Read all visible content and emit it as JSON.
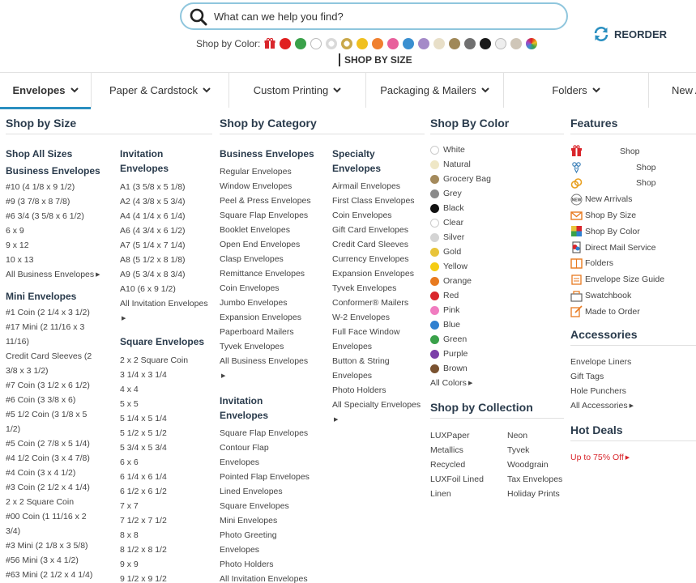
{
  "search": {
    "placeholder": "What can we help you find?"
  },
  "color_bar": {
    "label": "Shop by Color:",
    "swatches": [
      "#e02020",
      "#3aa14a",
      "#ffffff",
      "#d9d9d9",
      "#c9a84a",
      "#f0c020",
      "#f08030",
      "#e8609c",
      "#3a8fd0",
      "#a48ac8",
      "#e8dfc8",
      "#a08858",
      "#707070",
      "#1a1a1a",
      "#eeeeee",
      "#cfc6b8",
      "rainbow"
    ]
  },
  "shop_by_size_link": "SHOP BY SIZE",
  "reorder": {
    "label": "REORDER"
  },
  "nav": {
    "items": [
      {
        "label": "Envelopes",
        "active": true
      },
      {
        "label": "Paper & Cardstock",
        "active": false
      },
      {
        "label": "Custom Printing",
        "active": false
      },
      {
        "label": "Packaging & Mailers",
        "active": false
      },
      {
        "label": "Folders",
        "active": false
      },
      {
        "label": "New A",
        "active": false
      }
    ]
  },
  "shop_by_size": {
    "heading": "Shop by Size",
    "all_sizes": "Shop All Sizes",
    "business": {
      "heading": "Business Envelopes",
      "items": [
        "#10 (4 1/8 x 9 1/2)",
        "#9 (3 7/8 x 8 7/8)",
        "#6 3/4 (3 5/8 x 6 1/2)",
        "6 x 9",
        "9 x 12",
        "10 x 13"
      ],
      "all": "All Business Envelopes"
    },
    "mini": {
      "heading": "Mini Envelopes",
      "items": [
        "#1 Coin (2 1/4 x 3 1/2)",
        "#17 Mini (2 11/16 x 3",
        "11/16)",
        "Credit Card Sleeves (2",
        "3/8 x 3 1/2)",
        "#7 Coin (3 1/2 x 6 1/2)",
        "#6 Coin (3 3/8 x 6)",
        "#5 1/2 Coin (3 1/8 x 5",
        "1/2)",
        "#5 Coin (2 7/8 x 5 1/4)",
        "#4 1/2 Coin (3 x 4 7/8)",
        "#4 Coin (3 x 4 1/2)",
        "#3 Coin (2 1/2 x 4 1/4)",
        "2 x 2 Square Coin",
        "#00 Coin (1 11/16 x 2",
        "3/4)",
        "#3 Mini (2 1/8 x 3 5/8)",
        "#56 Mini (3 x 4 1/2)",
        "#63 Mini (2 1/2 x 4 1/4)"
      ]
    },
    "invitation": {
      "heading_1": "Invitation",
      "heading_2": "Envelopes",
      "items": [
        "A1 (3 5/8 x 5 1/8)",
        "A2 (4 3/8 x 5 3/4)",
        "A4 (4 1/4 x 6 1/4)",
        "A6 (4 3/4 x 6 1/2)",
        "A7 (5 1/4 x 7 1/4)",
        "A8 (5 1/2 x 8 1/8)",
        "A9 (5 3/4 x 8 3/4)",
        "A10 (6 x 9 1/2)"
      ],
      "all": "All Invitation Envelopes"
    },
    "square": {
      "heading": "Square Envelopes",
      "items": [
        "2 x 2 Square Coin",
        "3 1/4 x 3 1/4",
        "4 x 4",
        "5 x 5",
        "5 1/4 x 5 1/4",
        "5 1/2 x 5 1/2",
        "5 3/4 x 5 3/4",
        "6 x 6",
        "6 1/4 x 6 1/4",
        "6 1/2 x 6 1/2",
        "7 x 7",
        "7 1/2 x 7 1/2",
        "8 x 8",
        "8 1/2 x 8 1/2",
        "9 x 9",
        "9 1/2 x 9 1/2"
      ]
    }
  },
  "shop_by_category": {
    "heading": "Shop by Category",
    "business": {
      "heading": "Business Envelopes",
      "items": [
        "Regular Envelopes",
        "Window Envelopes",
        "Peel & Press Envelopes",
        "Square Flap Envelopes",
        "Booklet Envelopes",
        "Open End Envelopes",
        "Clasp Envelopes",
        "Remittance Envelopes",
        "Coin Envelopes",
        "Jumbo Envelopes",
        "Expansion Envelopes",
        "Paperboard Mailers",
        "Tyvek Envelopes"
      ],
      "all": "All Business Envelopes"
    },
    "invitation": {
      "heading_1": "Invitation",
      "heading_2": "Envelopes",
      "items": [
        "Square Flap Envelopes",
        "Contour Flap",
        "Envelopes",
        "Pointed Flap Envelopes",
        "Lined Envelopes",
        "Square Envelopes",
        "Mini Envelopes",
        "Photo Greeting",
        "Envelopes",
        "Photo Holders",
        "All Invitation Envelopes"
      ]
    },
    "specialty": {
      "heading": "Specialty Envelopes",
      "items": [
        "Airmail Envelopes",
        "First Class Envelopes",
        "Coin Envelopes",
        "Gift Card Envelopes",
        "Credit Card Sleeves",
        "Currency Envelopes",
        "Expansion Envelopes",
        "Tyvek Envelopes",
        "Conformer® Mailers",
        "W-2 Envelopes",
        "Full Face Window",
        "Envelopes",
        "Button & String",
        "Envelopes",
        "Photo Holders"
      ],
      "all": "All Specialty Envelopes"
    }
  },
  "shop_by_color": {
    "heading": "Shop By Color",
    "items": [
      {
        "name": "White",
        "color": "#ffffff"
      },
      {
        "name": "Natural",
        "color": "#efe7c6"
      },
      {
        "name": "Grocery Bag",
        "color": "#a48a5c"
      },
      {
        "name": "Grey",
        "color": "#8a8a8a"
      },
      {
        "name": "Black",
        "color": "#111111"
      },
      {
        "name": "Clear",
        "color": "#ffffff"
      },
      {
        "name": "Silver",
        "color": "#d4d4d4"
      },
      {
        "name": "Gold",
        "color": "#e8c43a"
      },
      {
        "name": "Yellow",
        "color": "#f5cc14"
      },
      {
        "name": "Orange",
        "color": "#e87a20"
      },
      {
        "name": "Red",
        "color": "#d9262c"
      },
      {
        "name": "Pink",
        "color": "#f07cc0"
      },
      {
        "name": "Blue",
        "color": "#2f80d0"
      },
      {
        "name": "Green",
        "color": "#3aa14a"
      },
      {
        "name": "Purple",
        "color": "#7b3fa8"
      },
      {
        "name": "Brown",
        "color": "#7a5230"
      }
    ],
    "all": "All Colors"
  },
  "shop_by_collection": {
    "heading": "Shop by Collection",
    "col1": [
      "LUXPaper",
      "Metallics",
      "Recycled",
      "LUXFoil Lined",
      "Linen"
    ],
    "col2": [
      "Neon",
      "Tyvek",
      "Woodgrain",
      "Tax Envelopes",
      "Holiday Prints"
    ]
  },
  "features": {
    "heading": "Features",
    "shop_items": [
      "Shop",
      "Shop",
      "Shop"
    ],
    "items": [
      {
        "label": "New Arrivals",
        "icon": "new-icon"
      },
      {
        "label": "Shop By Size",
        "icon": "envelope-icon"
      },
      {
        "label": "Shop By Color",
        "icon": "color-square-icon"
      },
      {
        "label": "Direct Mail Service",
        "icon": "direct-mail-icon"
      },
      {
        "label": "Folders",
        "icon": "folder-icon"
      },
      {
        "label": "Envelope Size Guide",
        "icon": "size-guide-icon"
      },
      {
        "label": "Swatchbook",
        "icon": "swatchbook-icon"
      },
      {
        "label": "Made to Order",
        "icon": "made-to-order-icon"
      }
    ]
  },
  "accessories": {
    "heading": "Accessories",
    "items": [
      "Envelope Liners",
      "Gift Tags",
      "Hole Punchers"
    ],
    "all": "All Accessories"
  },
  "hot_deals": {
    "heading": "Hot Deals",
    "link": "Up to 75% Off"
  },
  "colors": {
    "accent": "#2a8fc0",
    "heading": "#2a3b4c",
    "sale": "#d9262c",
    "search_border": "#8fc6dd"
  }
}
